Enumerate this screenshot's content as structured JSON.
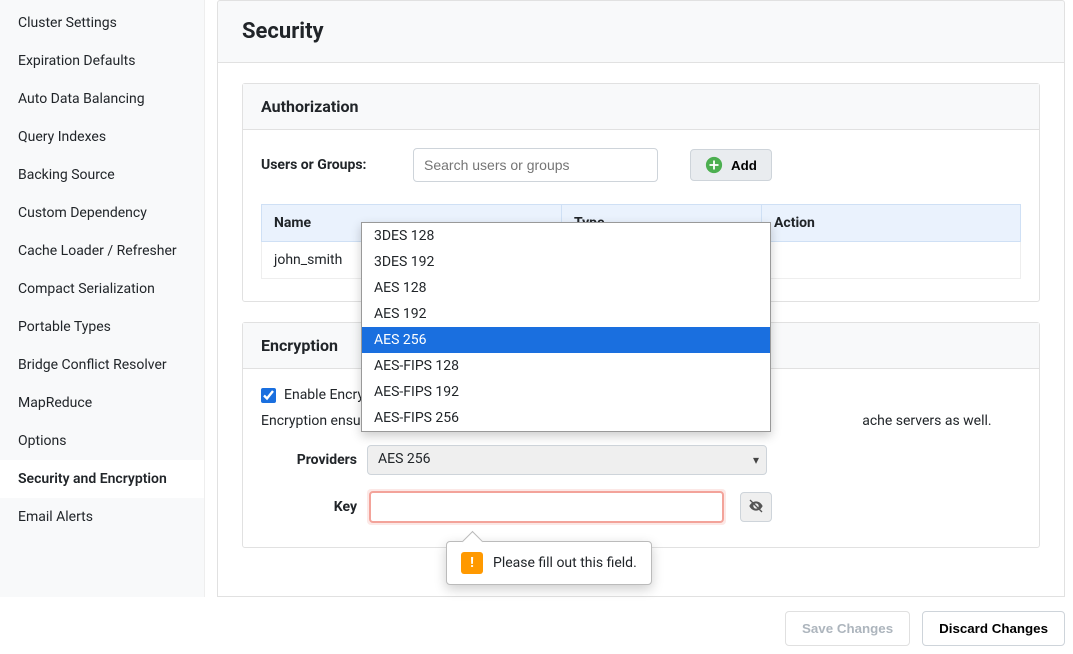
{
  "sidebar": {
    "items": [
      {
        "label": "Cluster Settings"
      },
      {
        "label": "Expiration Defaults"
      },
      {
        "label": "Auto Data Balancing"
      },
      {
        "label": "Query Indexes"
      },
      {
        "label": "Backing Source"
      },
      {
        "label": "Custom Dependency"
      },
      {
        "label": "Cache Loader / Refresher"
      },
      {
        "label": "Compact Serialization"
      },
      {
        "label": "Portable Types"
      },
      {
        "label": "Bridge Conflict Resolver"
      },
      {
        "label": "MapReduce"
      },
      {
        "label": "Options"
      },
      {
        "label": "Security and Encryption"
      },
      {
        "label": "Email Alerts"
      }
    ],
    "active_index": 12
  },
  "page": {
    "title": "Security"
  },
  "authorization": {
    "panel_title": "Authorization",
    "users_label": "Users or Groups:",
    "search_placeholder": "Search users or groups",
    "add_label": "Add",
    "table": {
      "headers": {
        "name": "Name",
        "type": "Type",
        "action": "Action"
      },
      "rows": [
        {
          "name": "john_smith"
        }
      ]
    }
  },
  "encryption": {
    "panel_title": "Encryption",
    "enable_label": "Enable Encryption",
    "enable_label_truncated": "Enable Encryp",
    "enabled": true,
    "description": "Encryption ensures the security of data traveling over the network and also of data stored in the cache servers as well.",
    "description_prefix": "Encryption ensure",
    "description_suffix": "ache servers as well.",
    "providers_label": "Providers",
    "selected_provider": "AES 256",
    "provider_options": [
      "3DES 128",
      "3DES 192",
      "AES 128",
      "AES 192",
      "AES 256",
      "AES-FIPS 128",
      "AES-FIPS 192",
      "AES-FIPS 256"
    ],
    "key_label": "Key",
    "key_value": "",
    "validation_message": "Please fill out this field."
  },
  "footer": {
    "save_label": "Save Changes",
    "discard_label": "Discard Changes"
  }
}
